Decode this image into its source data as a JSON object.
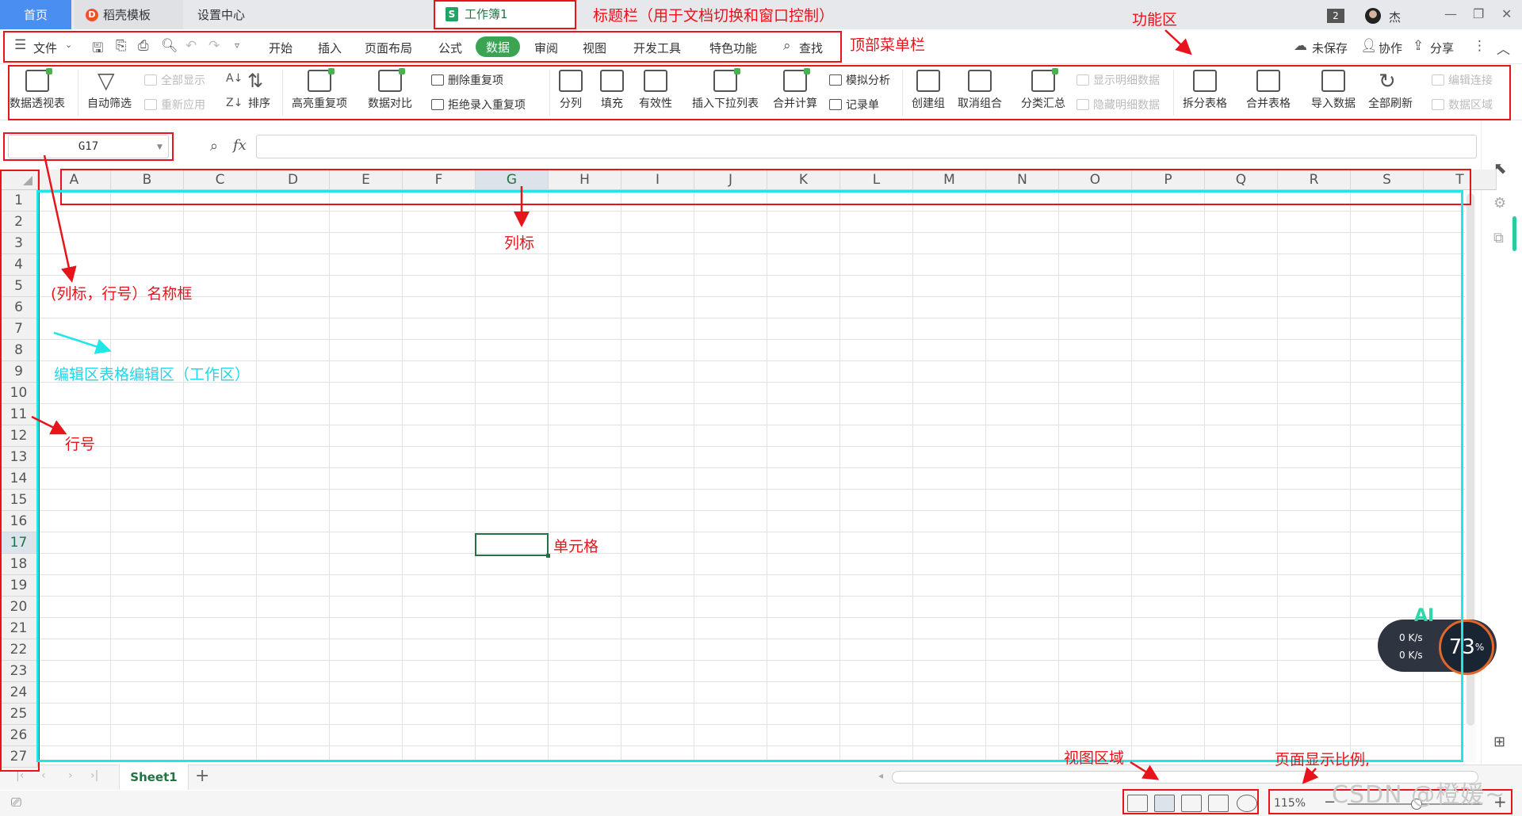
{
  "tabs": {
    "home": "首页",
    "template": "稻壳模板",
    "settings": "设置中心",
    "workbook_icon": "S",
    "workbook": "工作簿1"
  },
  "titlebar": {
    "window_count": "2",
    "user": "杰"
  },
  "menu": {
    "file": "文件",
    "items": [
      "开始",
      "插入",
      "页面布局",
      "公式",
      "数据",
      "审阅",
      "视图",
      "开发工具",
      "特色功能"
    ],
    "search": "查找",
    "unsaved": "未保存",
    "collab": "协作",
    "share": "分享"
  },
  "ribbon": {
    "pivot": "数据透视表",
    "autofilter": "自动筛选",
    "show_all": "全部显示",
    "reapply": "重新应用",
    "sort": "排序",
    "highlight_dup": "高亮重复项",
    "compare": "数据对比",
    "remove_dup": "删除重复项",
    "reject_dup": "拒绝录入重复项",
    "split_col": "分列",
    "fill": "填充",
    "validity": "有效性",
    "insert_dropdown": "插入下拉列表",
    "consolidate": "合并计算",
    "what_if": "模拟分析",
    "record_form": "记录单",
    "group": "创建组",
    "ungroup": "取消组合",
    "subtotal": "分类汇总",
    "show_detail": "显示明细数据",
    "hide_detail": "隐藏明细数据",
    "split_table": "拆分表格",
    "merge_table": "合并表格",
    "import": "导入数据",
    "refresh_all": "全部刷新",
    "edit_links": "编辑连接",
    "data_area": "数据区域"
  },
  "formula_bar": {
    "name_box": "G17",
    "fx": "fx",
    "value": ""
  },
  "columns": [
    "A",
    "B",
    "C",
    "D",
    "E",
    "F",
    "G",
    "H",
    "I",
    "J",
    "K",
    "L",
    "M",
    "N",
    "O",
    "P",
    "Q",
    "R",
    "S",
    "T"
  ],
  "rows": [
    "1",
    "2",
    "3",
    "4",
    "5",
    "6",
    "7",
    "8",
    "9",
    "10",
    "11",
    "12",
    "13",
    "14",
    "15",
    "16",
    "17",
    "18",
    "19",
    "20",
    "21",
    "22",
    "23",
    "24",
    "25",
    "26",
    "27"
  ],
  "selected": {
    "column": "G",
    "row": "17"
  },
  "sheets": [
    "Sheet1"
  ],
  "status": {
    "zoom": "115%"
  },
  "net_widget": {
    "up": "0 K/s",
    "down": "0 K/s",
    "percent": "73",
    "ai": "AI"
  },
  "annotations": {
    "title_bar": "标题栏（用于文档切换和窗口控制）",
    "function_area": "功能区",
    "top_menu": "顶部菜单栏",
    "column_label": "列标",
    "name_box": "(列标，行号）名称框",
    "edit_area": "编辑区表格编辑区（工作区）",
    "row_number": "行号",
    "cell": "单元格",
    "view_area": "视图区域",
    "zoom_ratio": "页面显示比例,"
  },
  "watermark": "CSDN @橙媛~",
  "colors": {
    "accent_green": "#3aa453",
    "home_tab": "#4b8ef2",
    "annotation_red": "#e8141b",
    "annotation_cyan": "#22e6e6"
  }
}
